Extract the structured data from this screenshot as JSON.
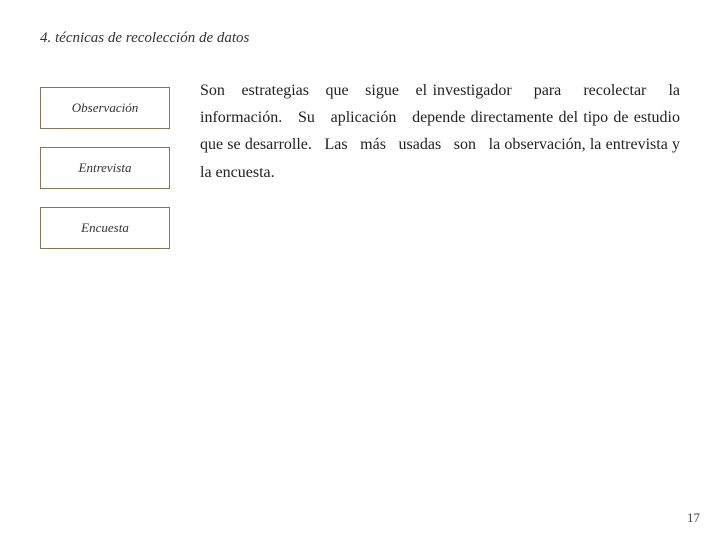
{
  "slide": {
    "title": "4. técnicas de recolección de datos",
    "labels": [
      {
        "id": "observacion",
        "text": "Observación"
      },
      {
        "id": "entrevista",
        "text": "Entrevista"
      },
      {
        "id": "encuesta",
        "text": "Encuesta"
      }
    ],
    "body_text": "Son  estrategias  que  sigue  el investigador   para   recolectar   la información.  Su  aplicación  depende directamente del tipo de estudio que se desarrolle.  Las  más  usadas  son  la observación, la entrevista y la encuesta.",
    "page_number": "17"
  }
}
